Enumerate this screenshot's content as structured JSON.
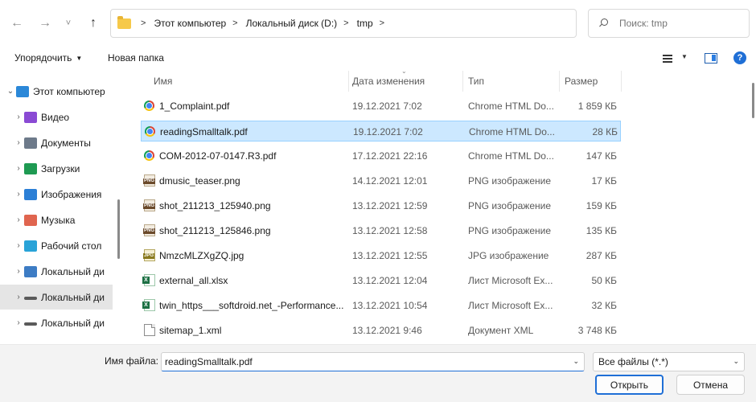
{
  "nav": {
    "back_glyph": "←",
    "forward_glyph": "→",
    "recent_glyph": "˅",
    "up_glyph": "↑"
  },
  "breadcrumb": [
    "Этот компьютер",
    "Локальный диск (D:)",
    "tmp"
  ],
  "search": {
    "placeholder": "Поиск: tmp"
  },
  "toolbar": {
    "organize_label": "Упорядочить",
    "new_folder_label": "Новая папка",
    "help_glyph": "?"
  },
  "sidebar": {
    "items": [
      {
        "label": "Этот компьютер",
        "icon": "monitor-icon",
        "color": "#2b88d8",
        "chevron": "⌄",
        "indent": 0
      },
      {
        "label": "Видео",
        "icon": "video-icon",
        "color": "#8a4ad4",
        "chevron": "›",
        "indent": 1
      },
      {
        "label": "Документы",
        "icon": "documents-icon",
        "color": "#6d7a8a",
        "chevron": "›",
        "indent": 1
      },
      {
        "label": "Загрузки",
        "icon": "download-icon",
        "color": "#1e9a52",
        "chevron": "›",
        "indent": 1
      },
      {
        "label": "Изображения",
        "icon": "pictures-icon",
        "color": "#2b7fd6",
        "chevron": "›",
        "indent": 1
      },
      {
        "label": "Музыка",
        "icon": "music-icon",
        "color": "#e0654f",
        "chevron": "›",
        "indent": 1
      },
      {
        "label": "Рабочий стол",
        "icon": "desktop-icon",
        "color": "#29a3d8",
        "chevron": "›",
        "indent": 1
      },
      {
        "label": "Локальный ди",
        "icon": "windows-drive-icon",
        "color": "#3d7cc4",
        "chevron": "›",
        "indent": 1
      },
      {
        "label": "Локальный ди",
        "icon": "drive-icon",
        "color": "#5a5a5a",
        "chevron": "›",
        "indent": 1,
        "selected": true
      },
      {
        "label": "Локальный ди",
        "icon": "drive-icon",
        "color": "#5a5a5a",
        "chevron": "›",
        "indent": 1
      }
    ]
  },
  "columns": {
    "name": "Имя",
    "date": "Дата изменения",
    "type": "Тип",
    "size": "Размер"
  },
  "files": [
    {
      "name": "1_Complaint.pdf",
      "date": "19.12.2021 7:02",
      "type": "Chrome HTML Do...",
      "size": "1 859 КБ",
      "icon": "chrome"
    },
    {
      "name": "readingSmalltalk.pdf",
      "date": "19.12.2021 7:02",
      "type": "Chrome HTML Do...",
      "size": "28 КБ",
      "icon": "chrome",
      "selected": true
    },
    {
      "name": "COM-2012-07-0147.R3.pdf",
      "date": "17.12.2021 22:16",
      "type": "Chrome HTML Do...",
      "size": "147 КБ",
      "icon": "chrome"
    },
    {
      "name": "dmusic_teaser.png",
      "date": "14.12.2021 12:01",
      "type": "PNG изображение",
      "size": "17 КБ",
      "icon": "png"
    },
    {
      "name": "shot_211213_125940.png",
      "date": "13.12.2021 12:59",
      "type": "PNG изображение",
      "size": "159 КБ",
      "icon": "png"
    },
    {
      "name": "shot_211213_125846.png",
      "date": "13.12.2021 12:58",
      "type": "PNG изображение",
      "size": "135 КБ",
      "icon": "png"
    },
    {
      "name": "NmzcMLZXgZQ.jpg",
      "date": "13.12.2021 12:55",
      "type": "JPG изображение",
      "size": "287 КБ",
      "icon": "jpg"
    },
    {
      "name": "external_all.xlsx",
      "date": "13.12.2021 12:04",
      "type": "Лист Microsoft Ex...",
      "size": "50 КБ",
      "icon": "xlsx"
    },
    {
      "name": "twin_https___softdroid.net_-Performance...",
      "date": "13.12.2021 10:54",
      "type": "Лист Microsoft Ex...",
      "size": "32 КБ",
      "icon": "xlsx"
    },
    {
      "name": "sitemap_1.xml",
      "date": "13.12.2021 9:46",
      "type": "Документ XML",
      "size": "3 748 КБ",
      "icon": "xml"
    }
  ],
  "footer": {
    "filename_label": "Имя файла:",
    "filename_value": "readingSmalltalk.pdf",
    "filetype_value": "Все файлы (*.*)",
    "open_label": "Открыть",
    "cancel_label": "Отмена"
  },
  "colors": {
    "accent": "#1f6fd6",
    "selection": "#cce8ff",
    "selection_border": "#99d1ff"
  }
}
